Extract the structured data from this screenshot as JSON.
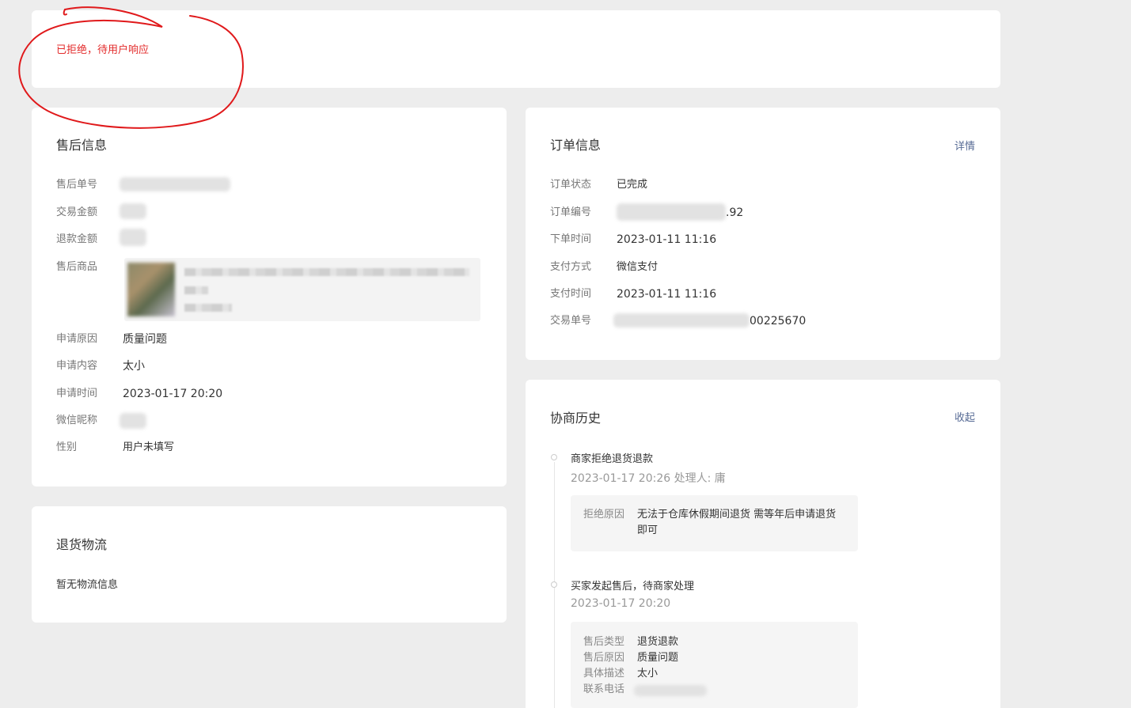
{
  "status": {
    "text": "已拒绝，待用户响应"
  },
  "after_sale": {
    "title": "售后信息",
    "rows": [
      {
        "label": "售后单号",
        "value": ""
      },
      {
        "label": "交易金额",
        "value": ""
      },
      {
        "label": "退款金额",
        "value": ""
      },
      {
        "label": "售后商品",
        "value": ""
      },
      {
        "label": "申请原因",
        "value": "质量问题"
      },
      {
        "label": "申请内容",
        "value": "太小"
      },
      {
        "label": "申请时间",
        "value": "2023-01-17 20:20"
      },
      {
        "label": "微信昵称",
        "value": ""
      },
      {
        "label": "性别",
        "value": "用户未填写"
      }
    ]
  },
  "return_logistics": {
    "title": "退货物流",
    "empty": "暂无物流信息"
  },
  "order": {
    "title": "订单信息",
    "detail_link": "详情",
    "rows": [
      {
        "label": "订单状态",
        "value": "已完成"
      },
      {
        "label": "订单编号",
        "value": ".92"
      },
      {
        "label": "下单时间",
        "value": "2023-01-11 11:16"
      },
      {
        "label": "支付方式",
        "value": "微信支付"
      },
      {
        "label": "支付时间",
        "value": "2023-01-11 11:16"
      },
      {
        "label": "交易单号",
        "value": "00225670"
      }
    ]
  },
  "history": {
    "title": "协商历史",
    "collapse_link": "收起",
    "events": [
      {
        "title": "商家拒绝退货退款",
        "sub": "2023-01-17 20:26 处理人: 庸",
        "details": [
          {
            "label": "拒绝原因",
            "value": "无法于仓库休假期间退货 需等年后申请退货即可"
          }
        ]
      },
      {
        "title": "买家发起售后，待商家处理",
        "sub": "2023-01-17 20:20",
        "details": [
          {
            "label": "售后类型",
            "value": "退货退款"
          },
          {
            "label": "售后原因",
            "value": "质量问题"
          },
          {
            "label": "具体描述",
            "value": "太小"
          },
          {
            "label": "联系电话",
            "value": ""
          }
        ]
      }
    ]
  },
  "colors": {
    "status_red": "#e32b2b",
    "link": "#576b95",
    "annotation": "#e0191b"
  }
}
